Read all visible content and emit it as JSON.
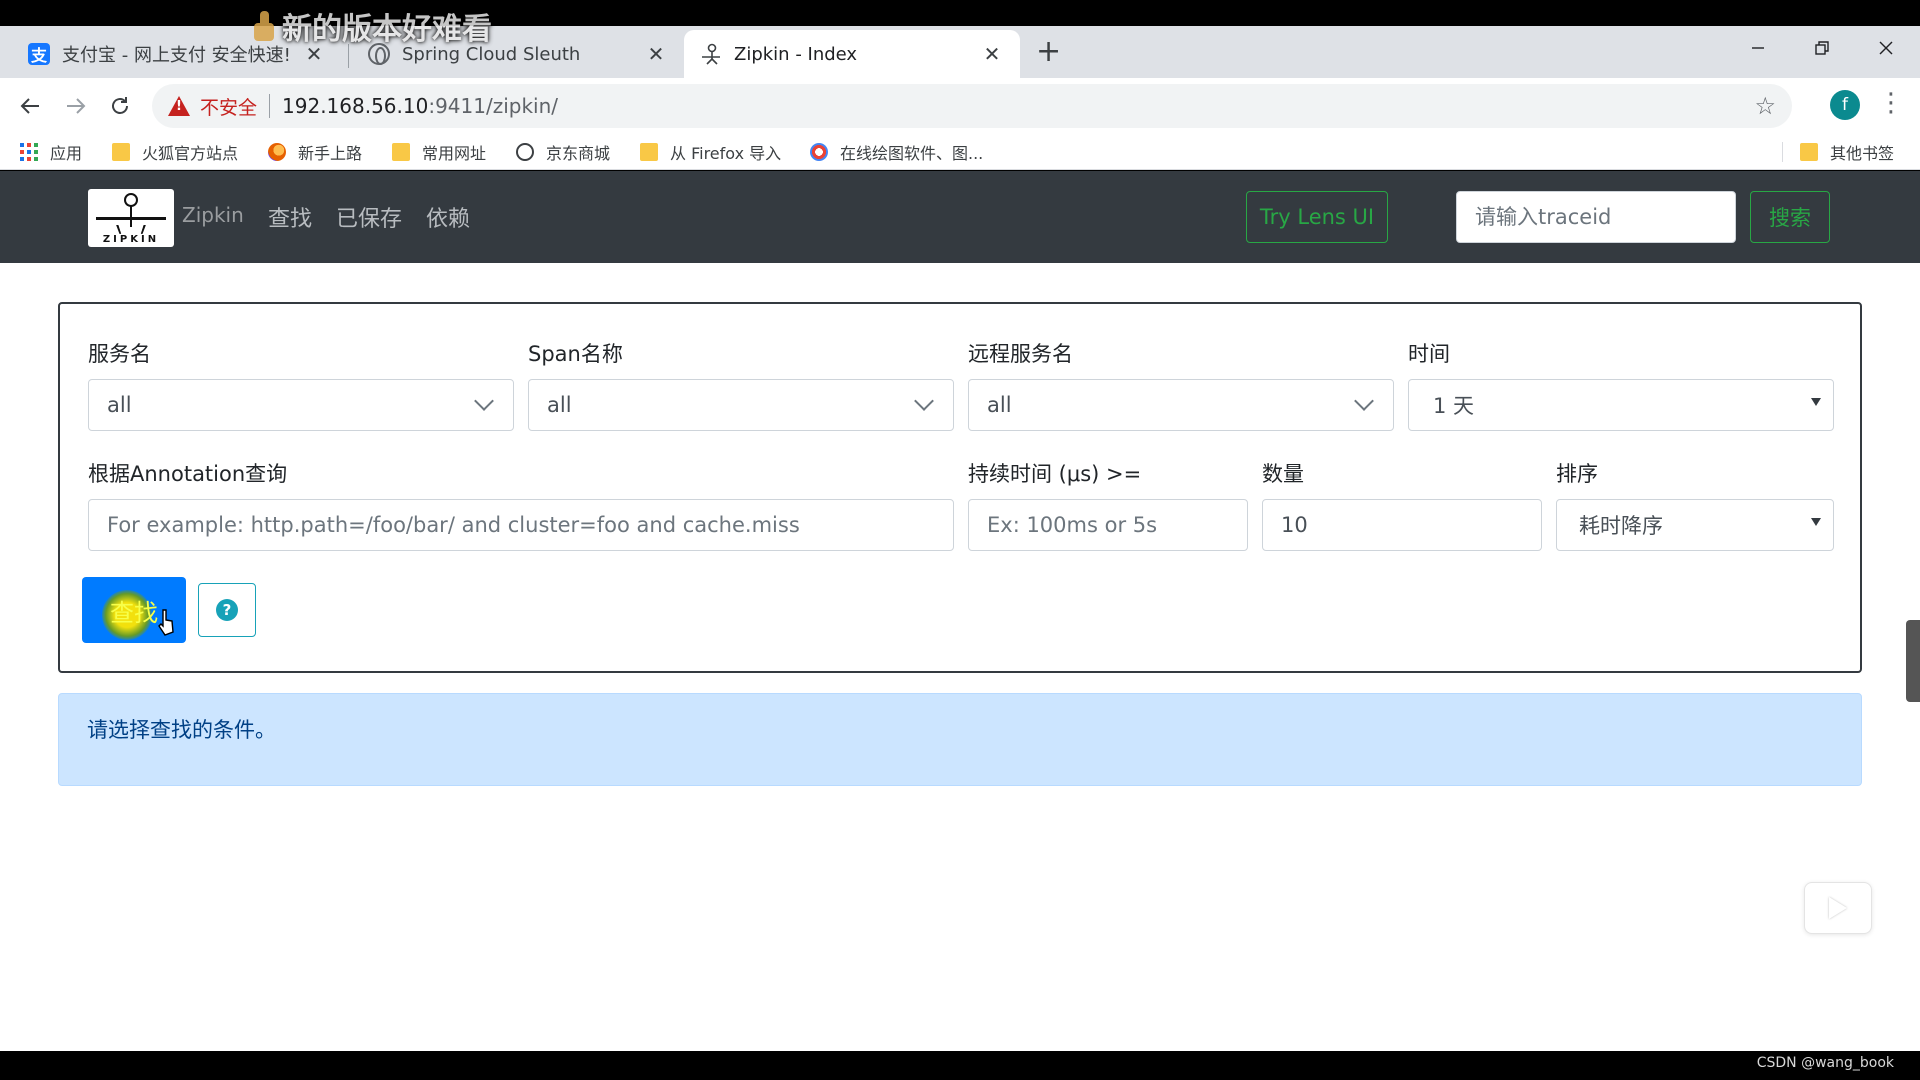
{
  "overlay": {
    "caption": "新的版本好难看"
  },
  "browser": {
    "tabs": [
      {
        "title": "支付宝 - 网上支付 安全快速!",
        "favicon": "alipay-icon",
        "favicon_glyph": "支"
      },
      {
        "title": "Spring Cloud Sleuth",
        "favicon": "globe-icon"
      },
      {
        "title": "Zipkin - Index",
        "favicon": "zipkin-icon",
        "active": true
      }
    ],
    "tab_close_glyph": "✕",
    "new_tab_glyph": "+",
    "address": {
      "security_label": "不安全",
      "url_host": "192.168.56.10",
      "url_path": ":9411/zipkin/"
    },
    "profile_initial": "f",
    "bookmarks": [
      {
        "label": "应用",
        "icon": "apps-icon"
      },
      {
        "label": "火狐官方站点",
        "icon": "folder-icon"
      },
      {
        "label": "新手上路",
        "icon": "firefox-icon"
      },
      {
        "label": "常用网址",
        "icon": "folder-icon"
      },
      {
        "label": "京东商城",
        "icon": "globe-icon"
      },
      {
        "label": "从 Firefox 导入",
        "icon": "folder-icon"
      },
      {
        "label": "在线绘图软件、图...",
        "icon": "drawing-icon"
      }
    ],
    "other_bookmarks": "其他书签"
  },
  "navbar": {
    "logo_text": "ZIPKIN",
    "brand": "Zipkin",
    "links": [
      "查找",
      "已保存",
      "依赖"
    ],
    "lens_button": "Try Lens UI",
    "traceid_placeholder": "请输入traceid",
    "search_button": "搜索"
  },
  "search_form": {
    "service_name": {
      "label": "服务名",
      "value": "all"
    },
    "span_name": {
      "label": "Span名称",
      "value": "all"
    },
    "remote_service": {
      "label": "远程服务名",
      "value": "all"
    },
    "time": {
      "label": "时间",
      "value": "1 天"
    },
    "annotation": {
      "label": "根据Annotation查询",
      "placeholder": "For example: http.path=/foo/bar/ and cluster=foo and cache.miss"
    },
    "duration": {
      "label": "持续时间 (μs) >=",
      "placeholder": "Ex: 100ms or 5s"
    },
    "limit": {
      "label": "数量",
      "value": "10"
    },
    "sort": {
      "label": "排序",
      "value": "耗时降序"
    },
    "find_button": "查找",
    "help_glyph": "?"
  },
  "alert": {
    "message": "请选择查找的条件。"
  },
  "watermark": "CSDN @wang_book"
}
